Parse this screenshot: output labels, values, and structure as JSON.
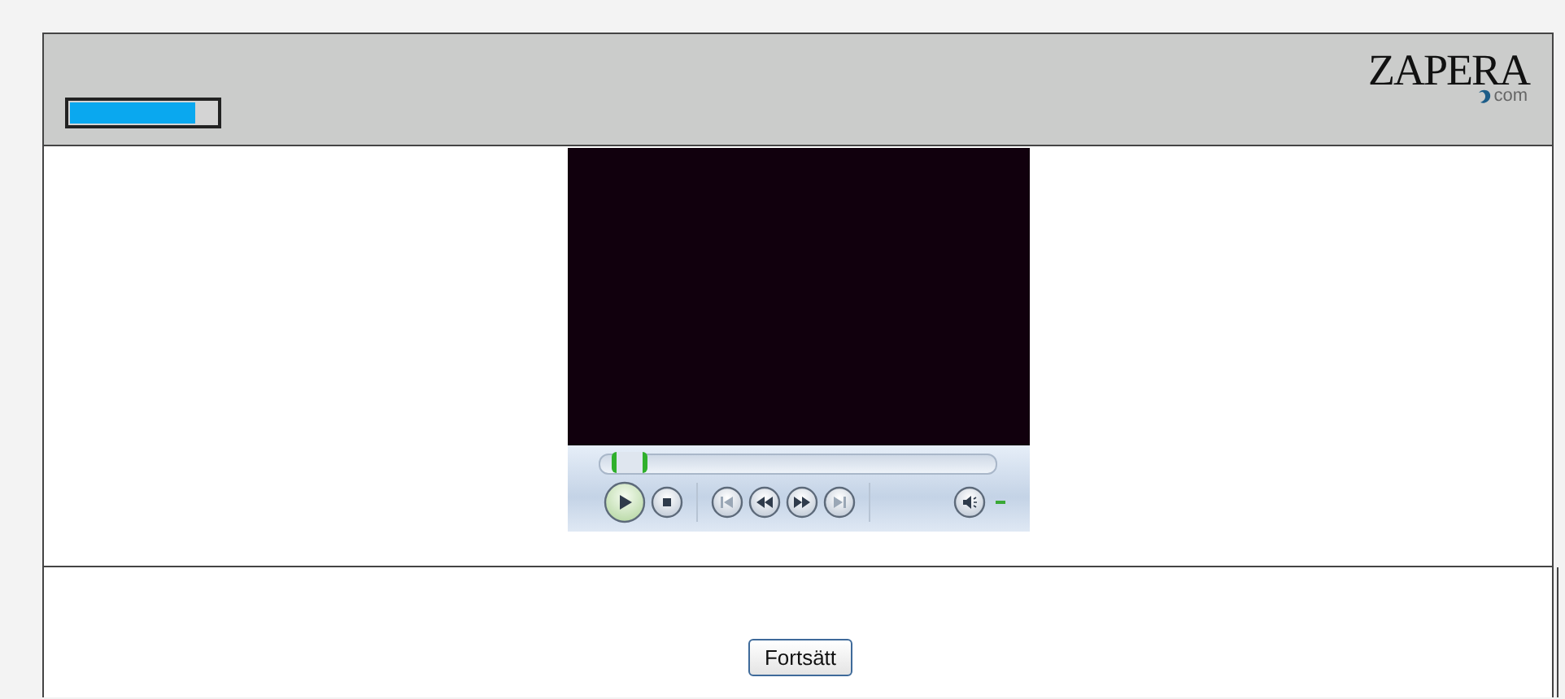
{
  "header": {
    "progress": {
      "level": 0.85
    },
    "logo": {
      "name": "ZAPERA",
      "suffix": "com"
    }
  },
  "player": {
    "seek": {
      "level": 0.03
    }
  },
  "footer": {
    "buttons": [
      "Fortsätt"
    ]
  }
}
